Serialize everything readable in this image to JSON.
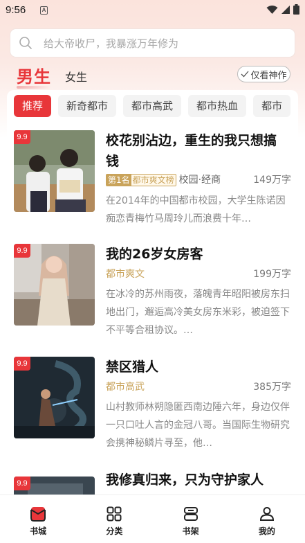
{
  "status_bar": {
    "time": "9:56",
    "notification_glyph": "A"
  },
  "search": {
    "placeholder": "给大帝收尸，我暴涨万年修为"
  },
  "gender_tabs": {
    "male": "男生",
    "female": "女生"
  },
  "filter": {
    "only_classic": "仅看神作"
  },
  "categories": [
    "推荐",
    "新奇都市",
    "都市高武",
    "都市热血",
    "都市"
  ],
  "active_category": "推荐",
  "books": [
    {
      "rating": "9.9",
      "title": "校花别沾边，重生的我只想搞钱",
      "rank": "第1名",
      "rank_list": "都市爽文榜",
      "category": "",
      "subcategory": "校园·经商",
      "words": "149万字",
      "description": "在2014年的中国都市校园，大学生陈诺因痴恋青梅竹马周玲儿而浪费十年…"
    },
    {
      "rating": "9.9",
      "title": "我的26岁女房客",
      "category": "都市爽文",
      "words": "199万字",
      "description": "在冰冷的苏州雨夜，落魄青年昭阳被房东扫地出门，邂逅高冷美女房东米彩，被迫签下不平等合租协议。…"
    },
    {
      "rating": "9.9",
      "title": "禁区猎人",
      "category": "都市高武",
      "words": "385万字",
      "description": "山村教师林朔隐匿西南边陲六年，身边仅伴一只口吐人言的金冠八哥。当国际生物研究会携神秘鳞片寻至，他…"
    },
    {
      "rating": "9.9",
      "title": "我修真归来，只为守护家人"
    }
  ],
  "bottom_nav": [
    {
      "label": "书城",
      "icon": "bookstore-icon",
      "active": true
    },
    {
      "label": "分类",
      "icon": "category-grid-icon",
      "active": false
    },
    {
      "label": "书架",
      "icon": "bookshelf-icon",
      "active": false
    },
    {
      "label": "我的",
      "icon": "profile-icon",
      "active": false
    }
  ],
  "colors": {
    "accent": "#e8363a",
    "gold": "#c9a35a",
    "background_top": "#fbe3dc"
  }
}
